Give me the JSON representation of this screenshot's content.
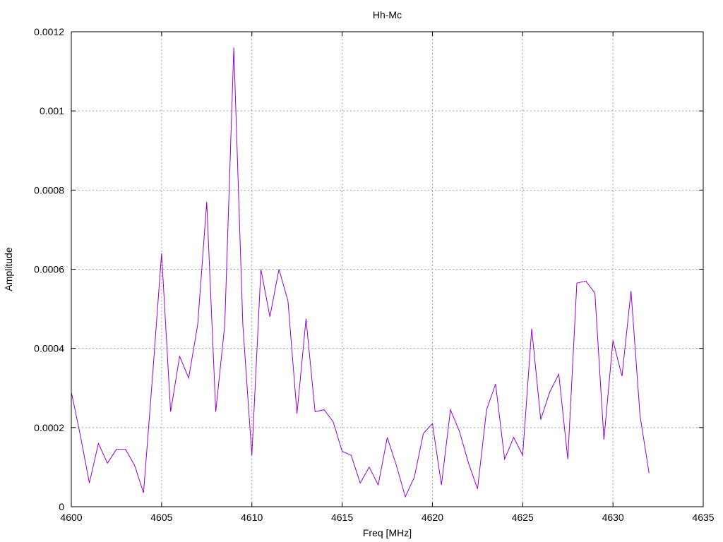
{
  "chart_data": {
    "type": "line",
    "title": "Hh-Mc",
    "xlabel": "Freq [MHz]",
    "ylabel": "Amplitude",
    "xlim": [
      4600,
      4635
    ],
    "ylim": [
      0,
      0.0012
    ],
    "xticks": [
      4600,
      4605,
      4610,
      4615,
      4620,
      4625,
      4630,
      4635
    ],
    "yticks": [
      0,
      0.0002,
      0.0004,
      0.0006,
      0.0008,
      0.001,
      0.0012
    ],
    "ytick_labels": [
      "0",
      "0.0002",
      "0.0004",
      "0.0006",
      "0.0008",
      "0.001",
      "0.0012"
    ],
    "grid": true,
    "series": [
      {
        "color": "#9400d3",
        "x": [
          4600,
          4600.5,
          4601,
          4601.5,
          4602,
          4602.5,
          4603,
          4603.5,
          4604,
          4604.5,
          4605,
          4605.5,
          4606,
          4606.5,
          4607,
          4607.5,
          4608,
          4608.5,
          4609,
          4609.5,
          4610,
          4610.5,
          4611,
          4611.5,
          4612,
          4612.5,
          4613,
          4613.5,
          4614,
          4614.5,
          4615,
          4615.5,
          4616,
          4616.5,
          4617,
          4617.5,
          4618,
          4618.5,
          4619,
          4619.5,
          4620,
          4620.5,
          4621,
          4621.5,
          4622,
          4622.5,
          4623,
          4623.5,
          4624,
          4624.5,
          4625,
          4625.5,
          4626,
          4626.5,
          4627,
          4627.5,
          4628,
          4628.5,
          4629,
          4629.5,
          4630,
          4630.5,
          4631,
          4631.5,
          4632
        ],
        "y": [
          0.00029,
          0.00018,
          6e-05,
          0.00016,
          0.00011,
          0.000145,
          0.000145,
          0.000105,
          3.5e-05,
          0.00033,
          0.00064,
          0.00024,
          0.00038,
          0.000325,
          0.00046,
          0.00077,
          0.00024,
          0.00046,
          0.00116,
          0.00046,
          0.00013,
          0.0006,
          0.00048,
          0.0006,
          0.00052,
          0.000235,
          0.000475,
          0.00024,
          0.000245,
          0.000215,
          0.00014,
          0.00013,
          6e-05,
          0.0001,
          5.5e-05,
          0.000175,
          0.000105,
          2.5e-05,
          7.5e-05,
          0.000185,
          0.00021,
          5.5e-05,
          0.000245,
          0.00019,
          0.00011,
          4.5e-05,
          0.000245,
          0.00031,
          0.00012,
          0.000175,
          0.00013,
          0.00045,
          0.00022,
          0.00029,
          0.000335,
          0.00012,
          0.000565,
          0.00057,
          0.00054,
          0.00017,
          0.00042,
          0.00033,
          0.000545,
          0.00023,
          8.5e-05
        ]
      }
    ]
  }
}
